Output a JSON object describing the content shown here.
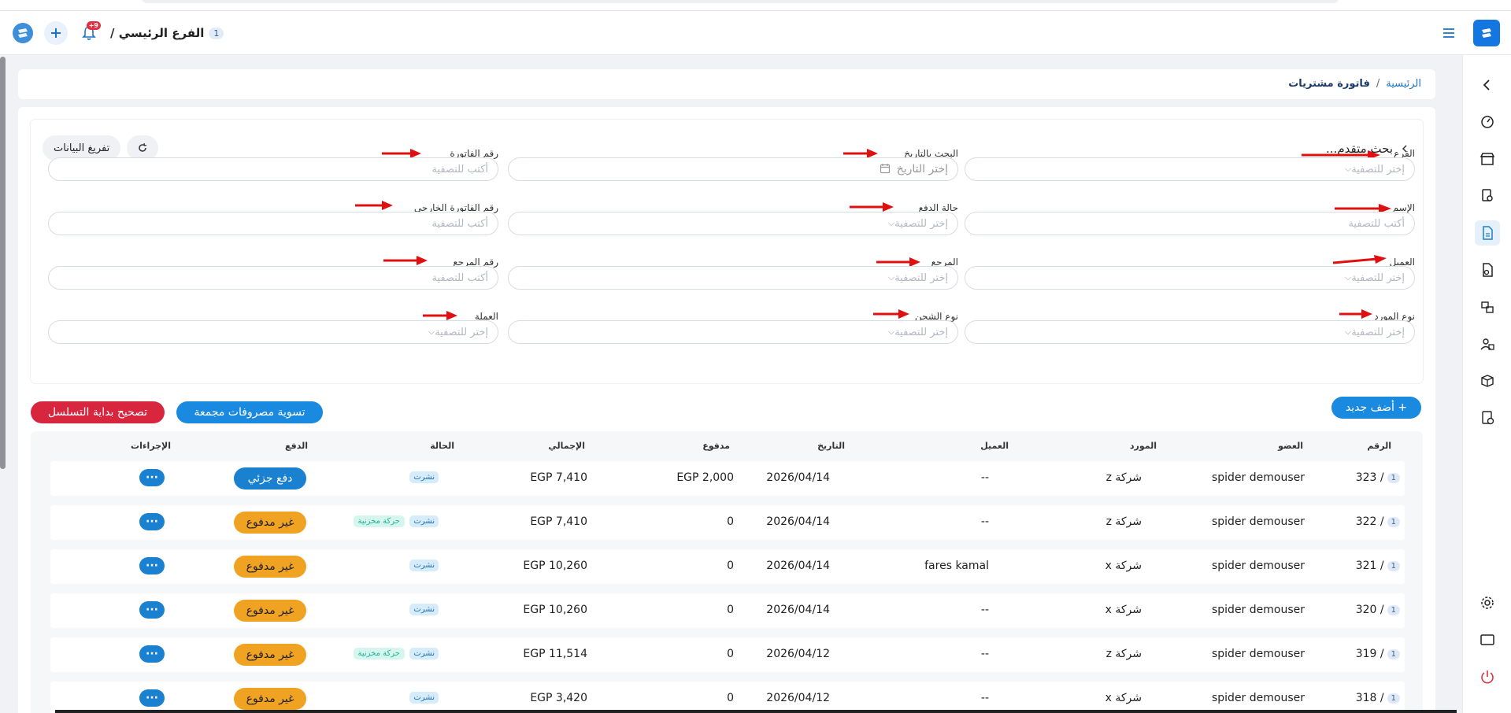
{
  "header": {
    "branch_number": "1",
    "branch_name": "الفرع الرئيسي /",
    "notification_count": "+9"
  },
  "breadcrumb": {
    "home": "الرئيسية",
    "separator": "/",
    "current": "فاتورة مشتريات"
  },
  "filters": {
    "title": "بحث متقدم...",
    "clear_button": "تفريغ البيانات",
    "fields": {
      "branch": {
        "label": "الفرع",
        "placeholder": "إختر للتصفية"
      },
      "date": {
        "label": "البحث بالتاريخ",
        "placeholder": "إختر التاريخ"
      },
      "invoice_no": {
        "label": "رقم الفاتورة",
        "placeholder": "أكتب للتصفية"
      },
      "name": {
        "label": "الإسم",
        "placeholder": "أكتب للتصفية"
      },
      "payment_status": {
        "label": "حالة الدفع",
        "placeholder": "إختر للتصفية"
      },
      "external_invoice": {
        "label": "رقم الفاتورة الخارجي",
        "placeholder": "أكتب للتصفية"
      },
      "customer": {
        "label": "العميل",
        "placeholder": "إختر للتصفية"
      },
      "reference": {
        "label": "المرجع",
        "placeholder": "إختر للتصفية"
      },
      "reference_no": {
        "label": "رقم المرجع",
        "placeholder": "أكتب للتصفية"
      },
      "supplier_type": {
        "label": "نوع المورد",
        "placeholder": "إختر للتصفية"
      },
      "shipping_type": {
        "label": "نوع الشحن",
        "placeholder": "إختر للتصفية"
      },
      "currency": {
        "label": "العملة",
        "placeholder": "إختر للتصفية"
      }
    }
  },
  "actions": {
    "add_new": "+ أضف جديد",
    "bulk_settle": "تسوية مصروفات مجمعة",
    "fix_sequence": "تصحيح بداية التسلسل"
  },
  "table": {
    "headers": {
      "number": "الرقم",
      "member": "العضو",
      "supplier": "المورد",
      "customer": "العميل",
      "date": "التاريخ",
      "paid": "مدفوع",
      "total": "الإجمالي",
      "status": "الحالة",
      "payment": "الدفع",
      "actions": "الإجراءات"
    },
    "rows": [
      {
        "badge": "1",
        "num": "323 /",
        "member": "spider demouser",
        "supplier": "شركة z",
        "customer": "--",
        "date": "2026/04/14",
        "paid": "EGP 2,000",
        "total": "EGP 7,410",
        "status": "نشرت",
        "stock": "",
        "payment": "دفع جزئي",
        "pay_type": "partial",
        "more": "···"
      },
      {
        "badge": "1",
        "num": "322 /",
        "member": "spider demouser",
        "supplier": "شركة z",
        "customer": "--",
        "date": "2026/04/14",
        "paid": "0",
        "total": "EGP 7,410",
        "status": "نشرت",
        "stock": "حركة مخزنية",
        "payment": "غير مدفوع",
        "pay_type": "unpaid",
        "more": "···"
      },
      {
        "badge": "1",
        "num": "321 /",
        "member": "spider demouser",
        "supplier": "شركة x",
        "customer": "fares kamal",
        "date": "2026/04/14",
        "paid": "0",
        "total": "EGP 10,260",
        "status": "نشرت",
        "stock": "",
        "payment": "غير مدفوع",
        "pay_type": "unpaid",
        "more": "···"
      },
      {
        "badge": "1",
        "num": "320 /",
        "member": "spider demouser",
        "supplier": "شركة x",
        "customer": "--",
        "date": "2026/04/14",
        "paid": "0",
        "total": "EGP 10,260",
        "status": "نشرت",
        "stock": "",
        "payment": "غير مدفوع",
        "pay_type": "unpaid",
        "more": "···"
      },
      {
        "badge": "1",
        "num": "319 /",
        "member": "spider demouser",
        "supplier": "شركة z",
        "customer": "--",
        "date": "2026/04/12",
        "paid": "0",
        "total": "EGP 11,514",
        "status": "نشرت",
        "stock": "حركة مخزنية",
        "payment": "غير مدفوع",
        "pay_type": "unpaid",
        "more": "···"
      },
      {
        "badge": "1",
        "num": "318 /",
        "member": "spider demouser",
        "supplier": "شركة x",
        "customer": "--",
        "date": "2026/04/12",
        "paid": "0",
        "total": "EGP 3,420",
        "status": "نشرت",
        "stock": "",
        "payment": "غير مدفوع",
        "pay_type": "unpaid",
        "more": "···"
      }
    ]
  },
  "colors": {
    "accent": "#1a80d0",
    "danger": "#d7263d",
    "unpaid": "#f0a323",
    "arrow": "#e01010"
  },
  "sidebar_icons": [
    "back-chevron-icon",
    "dashboard-icon",
    "store-icon",
    "search-doc-icon",
    "invoice-icon",
    "doc-icon",
    "boxes-icon",
    "users-icon",
    "package-icon",
    "report-icon",
    "settings-icon",
    "window-icon",
    "power-icon"
  ]
}
